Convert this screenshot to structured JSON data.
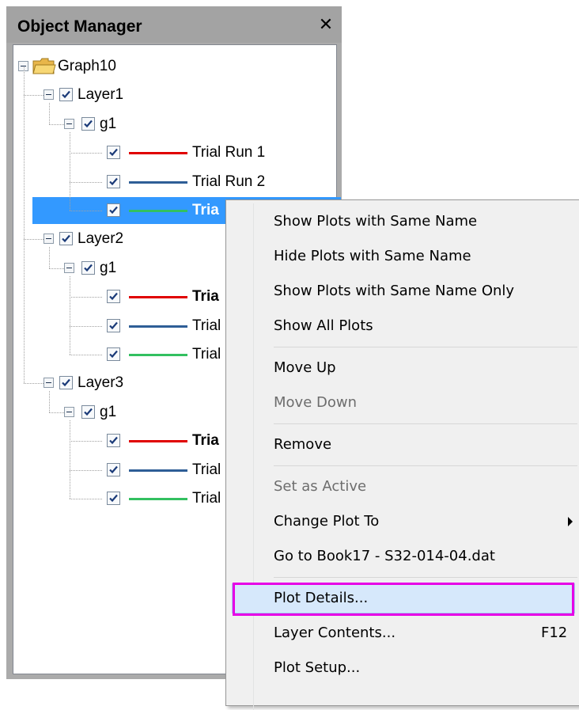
{
  "panel": {
    "title": "Object Manager",
    "close_glyph": "✕"
  },
  "tree": [
    {
      "level": 0,
      "type": "folder",
      "label": "Graph10"
    },
    {
      "level": 1,
      "type": "layer",
      "label": "Layer1"
    },
    {
      "level": 2,
      "type": "group",
      "label": "g1"
    },
    {
      "level": 3,
      "type": "plot",
      "label": "Trial Run 1",
      "color": "#e00000",
      "bold": false
    },
    {
      "level": 3,
      "type": "plot",
      "label": "Trial Run 2",
      "color": "#2e5e96",
      "bold": false
    },
    {
      "level": 3,
      "type": "plot",
      "label": "Tria",
      "color": "#33c060",
      "bold": true,
      "selected": true
    },
    {
      "level": 1,
      "type": "layer",
      "label": "Layer2"
    },
    {
      "level": 2,
      "type": "group",
      "label": "g1"
    },
    {
      "level": 3,
      "type": "plot",
      "label": "Tria",
      "color": "#e00000",
      "bold": true
    },
    {
      "level": 3,
      "type": "plot",
      "label": "Trial",
      "color": "#2e5e96",
      "bold": false
    },
    {
      "level": 3,
      "type": "plot",
      "label": "Trial",
      "color": "#33c060",
      "bold": false
    },
    {
      "level": 1,
      "type": "layer",
      "label": "Layer3"
    },
    {
      "level": 2,
      "type": "group",
      "label": "g1"
    },
    {
      "level": 3,
      "type": "plot",
      "label": "Tria",
      "color": "#e00000",
      "bold": true
    },
    {
      "level": 3,
      "type": "plot",
      "label": "Trial",
      "color": "#2e5e96",
      "bold": false
    },
    {
      "level": 3,
      "type": "plot",
      "label": "Trial",
      "color": "#33c060",
      "bold": false
    }
  ],
  "context_menu": {
    "items": [
      {
        "label": "Show Plots with Same Name"
      },
      {
        "label": "Hide Plots with Same Name"
      },
      {
        "label": "Show Plots with Same Name Only"
      },
      {
        "label": "Show All Plots"
      },
      {
        "separator": true
      },
      {
        "label": "Move Up"
      },
      {
        "label": "Move Down",
        "disabled": true
      },
      {
        "separator": true
      },
      {
        "label": "Remove"
      },
      {
        "separator": true
      },
      {
        "label": "Set as Active",
        "disabled": true
      },
      {
        "label": "Change Plot To",
        "submenu": true
      },
      {
        "label": "Go to Book17 - S32-014-04.dat"
      },
      {
        "separator": true
      },
      {
        "label": "Plot Details...",
        "highlighted": true
      },
      {
        "label": "Layer Contents...",
        "shortcut": "F12"
      },
      {
        "label": "Plot Setup..."
      }
    ]
  },
  "icons": {
    "folder": "folder-icon",
    "checkbox": "checkbox-checked-icon",
    "collapse": "minus-box-icon",
    "submenu": "chevron-right-icon"
  },
  "colors": {
    "selection": "#3399ff",
    "highlight_border": "#e600e6",
    "red_series": "#e00000",
    "blue_series": "#2e5e96",
    "green_series": "#33c060"
  }
}
